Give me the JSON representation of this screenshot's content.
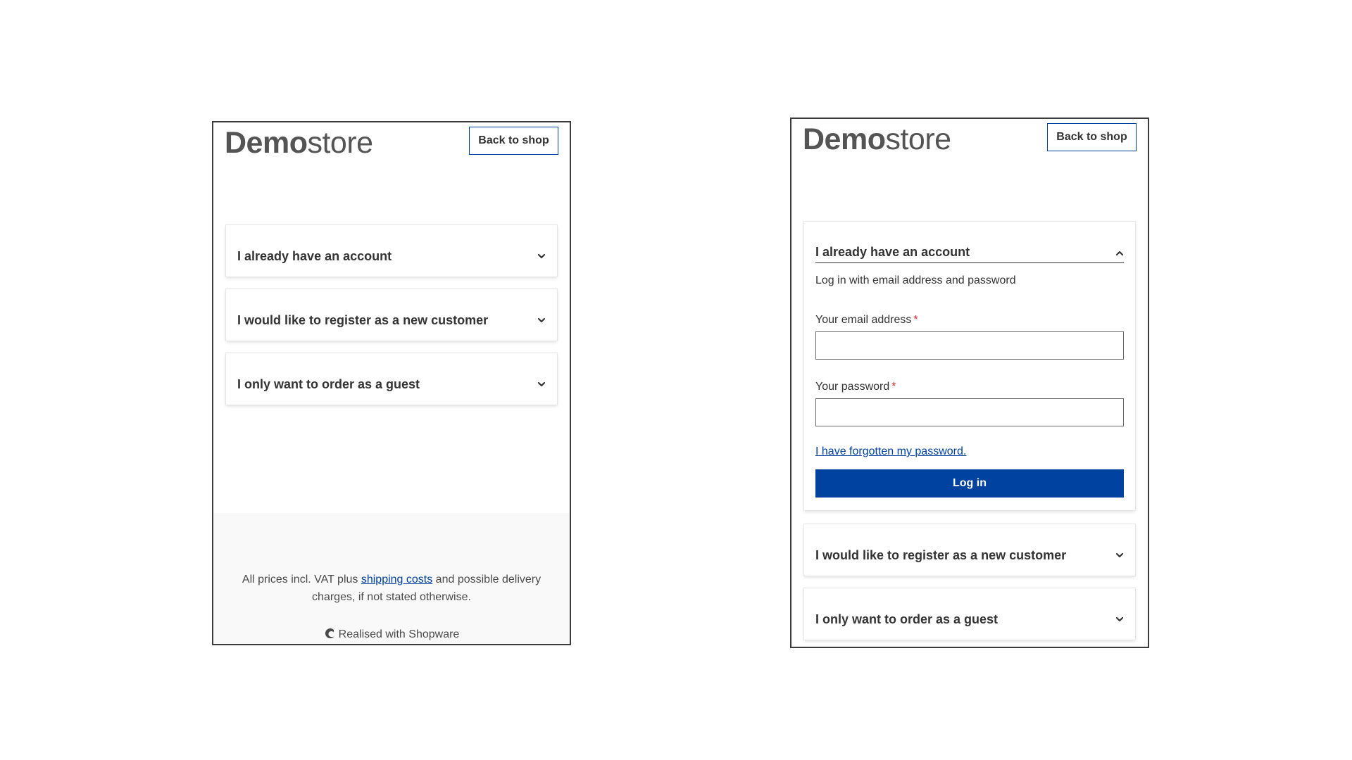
{
  "logo": {
    "strong": "Demo",
    "light": "store"
  },
  "back_to_shop": "Back to shop",
  "accordion": {
    "account_title": "I already have an account",
    "register_title": "I would like to register as a new customer",
    "guest_title": "I only want to order as a guest"
  },
  "login": {
    "subtitle": "Log in with email address and password",
    "email_label": "Your email address",
    "password_label": "Your password",
    "required_mark": "*",
    "forgot_link": "I have forgotten my password.",
    "submit_label": "Log in"
  },
  "footer": {
    "text_before": "All prices incl. VAT plus ",
    "shipping_link": "shipping costs",
    "text_after": " and possible delivery charges, if not stated otherwise.",
    "realised": "Realised with Shopware"
  },
  "icons": {
    "chevron_down": "chevron-down-icon",
    "chevron_up": "chevron-up-icon",
    "shopware": "shopware-logo-icon"
  },
  "colors": {
    "brand_blue": "#0042a0",
    "required_red": "#e52427",
    "text": "#333333",
    "footer_bg": "#f9f9f9"
  }
}
